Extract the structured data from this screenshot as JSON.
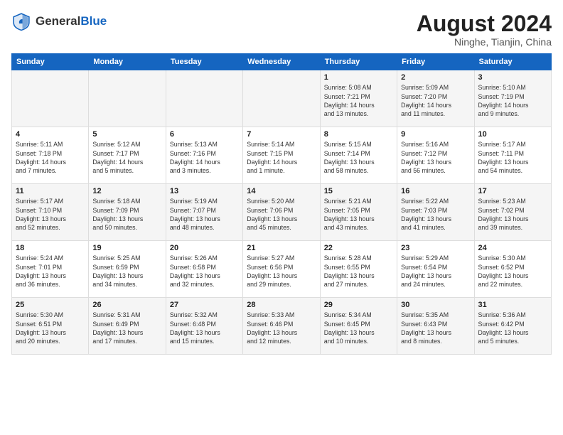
{
  "header": {
    "logo_general": "General",
    "logo_blue": "Blue",
    "month_year": "August 2024",
    "location": "Ninghe, Tianjin, China"
  },
  "days_of_week": [
    "Sunday",
    "Monday",
    "Tuesday",
    "Wednesday",
    "Thursday",
    "Friday",
    "Saturday"
  ],
  "weeks": [
    [
      {
        "day": "",
        "info": ""
      },
      {
        "day": "",
        "info": ""
      },
      {
        "day": "",
        "info": ""
      },
      {
        "day": "",
        "info": ""
      },
      {
        "day": "1",
        "info": "Sunrise: 5:08 AM\nSunset: 7:21 PM\nDaylight: 14 hours\nand 13 minutes."
      },
      {
        "day": "2",
        "info": "Sunrise: 5:09 AM\nSunset: 7:20 PM\nDaylight: 14 hours\nand 11 minutes."
      },
      {
        "day": "3",
        "info": "Sunrise: 5:10 AM\nSunset: 7:19 PM\nDaylight: 14 hours\nand 9 minutes."
      }
    ],
    [
      {
        "day": "4",
        "info": "Sunrise: 5:11 AM\nSunset: 7:18 PM\nDaylight: 14 hours\nand 7 minutes."
      },
      {
        "day": "5",
        "info": "Sunrise: 5:12 AM\nSunset: 7:17 PM\nDaylight: 14 hours\nand 5 minutes."
      },
      {
        "day": "6",
        "info": "Sunrise: 5:13 AM\nSunset: 7:16 PM\nDaylight: 14 hours\nand 3 minutes."
      },
      {
        "day": "7",
        "info": "Sunrise: 5:14 AM\nSunset: 7:15 PM\nDaylight: 14 hours\nand 1 minute."
      },
      {
        "day": "8",
        "info": "Sunrise: 5:15 AM\nSunset: 7:14 PM\nDaylight: 13 hours\nand 58 minutes."
      },
      {
        "day": "9",
        "info": "Sunrise: 5:16 AM\nSunset: 7:12 PM\nDaylight: 13 hours\nand 56 minutes."
      },
      {
        "day": "10",
        "info": "Sunrise: 5:17 AM\nSunset: 7:11 PM\nDaylight: 13 hours\nand 54 minutes."
      }
    ],
    [
      {
        "day": "11",
        "info": "Sunrise: 5:17 AM\nSunset: 7:10 PM\nDaylight: 13 hours\nand 52 minutes."
      },
      {
        "day": "12",
        "info": "Sunrise: 5:18 AM\nSunset: 7:09 PM\nDaylight: 13 hours\nand 50 minutes."
      },
      {
        "day": "13",
        "info": "Sunrise: 5:19 AM\nSunset: 7:07 PM\nDaylight: 13 hours\nand 48 minutes."
      },
      {
        "day": "14",
        "info": "Sunrise: 5:20 AM\nSunset: 7:06 PM\nDaylight: 13 hours\nand 45 minutes."
      },
      {
        "day": "15",
        "info": "Sunrise: 5:21 AM\nSunset: 7:05 PM\nDaylight: 13 hours\nand 43 minutes."
      },
      {
        "day": "16",
        "info": "Sunrise: 5:22 AM\nSunset: 7:03 PM\nDaylight: 13 hours\nand 41 minutes."
      },
      {
        "day": "17",
        "info": "Sunrise: 5:23 AM\nSunset: 7:02 PM\nDaylight: 13 hours\nand 39 minutes."
      }
    ],
    [
      {
        "day": "18",
        "info": "Sunrise: 5:24 AM\nSunset: 7:01 PM\nDaylight: 13 hours\nand 36 minutes."
      },
      {
        "day": "19",
        "info": "Sunrise: 5:25 AM\nSunset: 6:59 PM\nDaylight: 13 hours\nand 34 minutes."
      },
      {
        "day": "20",
        "info": "Sunrise: 5:26 AM\nSunset: 6:58 PM\nDaylight: 13 hours\nand 32 minutes."
      },
      {
        "day": "21",
        "info": "Sunrise: 5:27 AM\nSunset: 6:56 PM\nDaylight: 13 hours\nand 29 minutes."
      },
      {
        "day": "22",
        "info": "Sunrise: 5:28 AM\nSunset: 6:55 PM\nDaylight: 13 hours\nand 27 minutes."
      },
      {
        "day": "23",
        "info": "Sunrise: 5:29 AM\nSunset: 6:54 PM\nDaylight: 13 hours\nand 24 minutes."
      },
      {
        "day": "24",
        "info": "Sunrise: 5:30 AM\nSunset: 6:52 PM\nDaylight: 13 hours\nand 22 minutes."
      }
    ],
    [
      {
        "day": "25",
        "info": "Sunrise: 5:30 AM\nSunset: 6:51 PM\nDaylight: 13 hours\nand 20 minutes."
      },
      {
        "day": "26",
        "info": "Sunrise: 5:31 AM\nSunset: 6:49 PM\nDaylight: 13 hours\nand 17 minutes."
      },
      {
        "day": "27",
        "info": "Sunrise: 5:32 AM\nSunset: 6:48 PM\nDaylight: 13 hours\nand 15 minutes."
      },
      {
        "day": "28",
        "info": "Sunrise: 5:33 AM\nSunset: 6:46 PM\nDaylight: 13 hours\nand 12 minutes."
      },
      {
        "day": "29",
        "info": "Sunrise: 5:34 AM\nSunset: 6:45 PM\nDaylight: 13 hours\nand 10 minutes."
      },
      {
        "day": "30",
        "info": "Sunrise: 5:35 AM\nSunset: 6:43 PM\nDaylight: 13 hours\nand 8 minutes."
      },
      {
        "day": "31",
        "info": "Sunrise: 5:36 AM\nSunset: 6:42 PM\nDaylight: 13 hours\nand 5 minutes."
      }
    ]
  ]
}
